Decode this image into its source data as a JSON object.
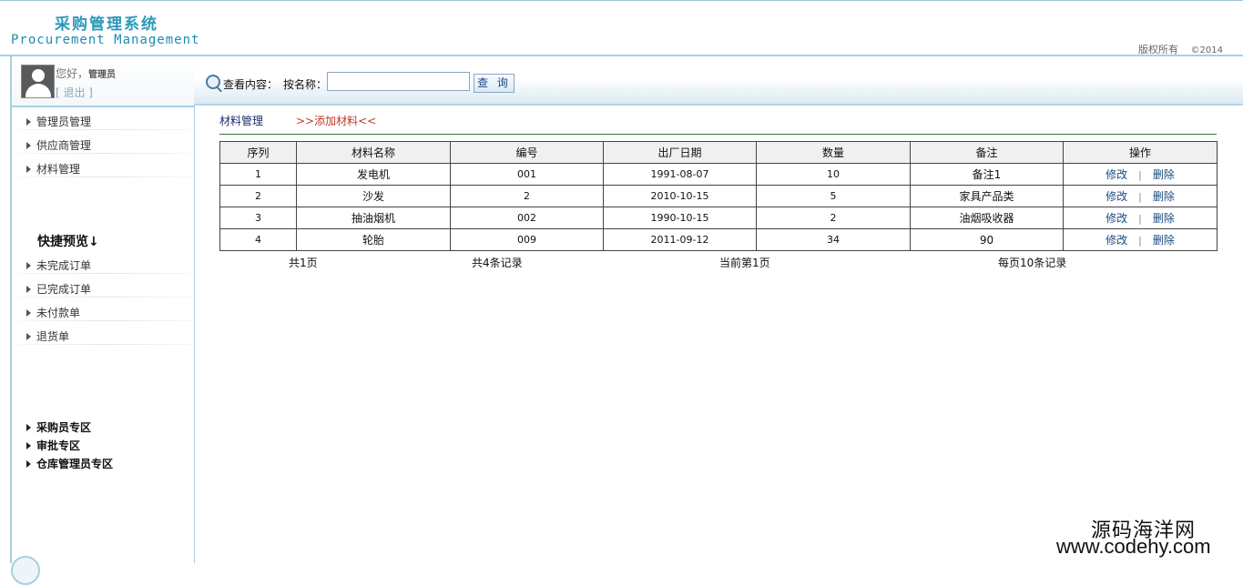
{
  "header": {
    "title_cn": "采购管理系统",
    "title_en": "Procurement Management",
    "copyright": "版权所有",
    "year": "©2014"
  },
  "user": {
    "greeting": "您好，",
    "role": "管理员",
    "logout": "[ 退出 ]"
  },
  "menu": {
    "items": [
      {
        "label": "管理员管理"
      },
      {
        "label": "供应商管理"
      },
      {
        "label": "材料管理"
      }
    ],
    "quick_title": "快捷预览↓",
    "quick_items": [
      {
        "label": "未完成订单"
      },
      {
        "label": "已完成订单"
      },
      {
        "label": "未付款单"
      },
      {
        "label": "退货单"
      }
    ],
    "zones": [
      {
        "label": "采购员专区"
      },
      {
        "label": "审批专区"
      },
      {
        "label": "仓库管理员专区"
      }
    ]
  },
  "search": {
    "label": "查看内容：",
    "by_label": "按名称：",
    "value": "",
    "button": "查 询"
  },
  "breadcrumb": {
    "section": "材料管理",
    "add_link": ">>添加材料<<"
  },
  "table": {
    "headers": [
      "序列",
      "材料名称",
      "编号",
      "出厂日期",
      "数量",
      "备注",
      "操作"
    ],
    "rows": [
      {
        "seq": "1",
        "name": "发电机",
        "code": "001",
        "date": "1991-08-07",
        "qty": "10",
        "note": "备注1"
      },
      {
        "seq": "2",
        "name": "沙发",
        "code": "2",
        "date": "2010-10-15",
        "qty": "5",
        "note": "家具产品类"
      },
      {
        "seq": "3",
        "name": "抽油烟机",
        "code": "002",
        "date": "1990-10-15",
        "qty": "2",
        "note": "油烟吸收器"
      },
      {
        "seq": "4",
        "name": "轮胎",
        "code": "009",
        "date": "2011-09-12",
        "qty": "34",
        "note": "90"
      }
    ],
    "edit_label": "修改",
    "sep": "|",
    "delete_label": "删除"
  },
  "pager": {
    "total_pages": "共1页",
    "total_records": "共4条记录",
    "current_page": "当前第1页",
    "per_page": "每页10条记录"
  },
  "watermark": {
    "cn": "源码海洋网",
    "url": "www.codehy.com"
  }
}
